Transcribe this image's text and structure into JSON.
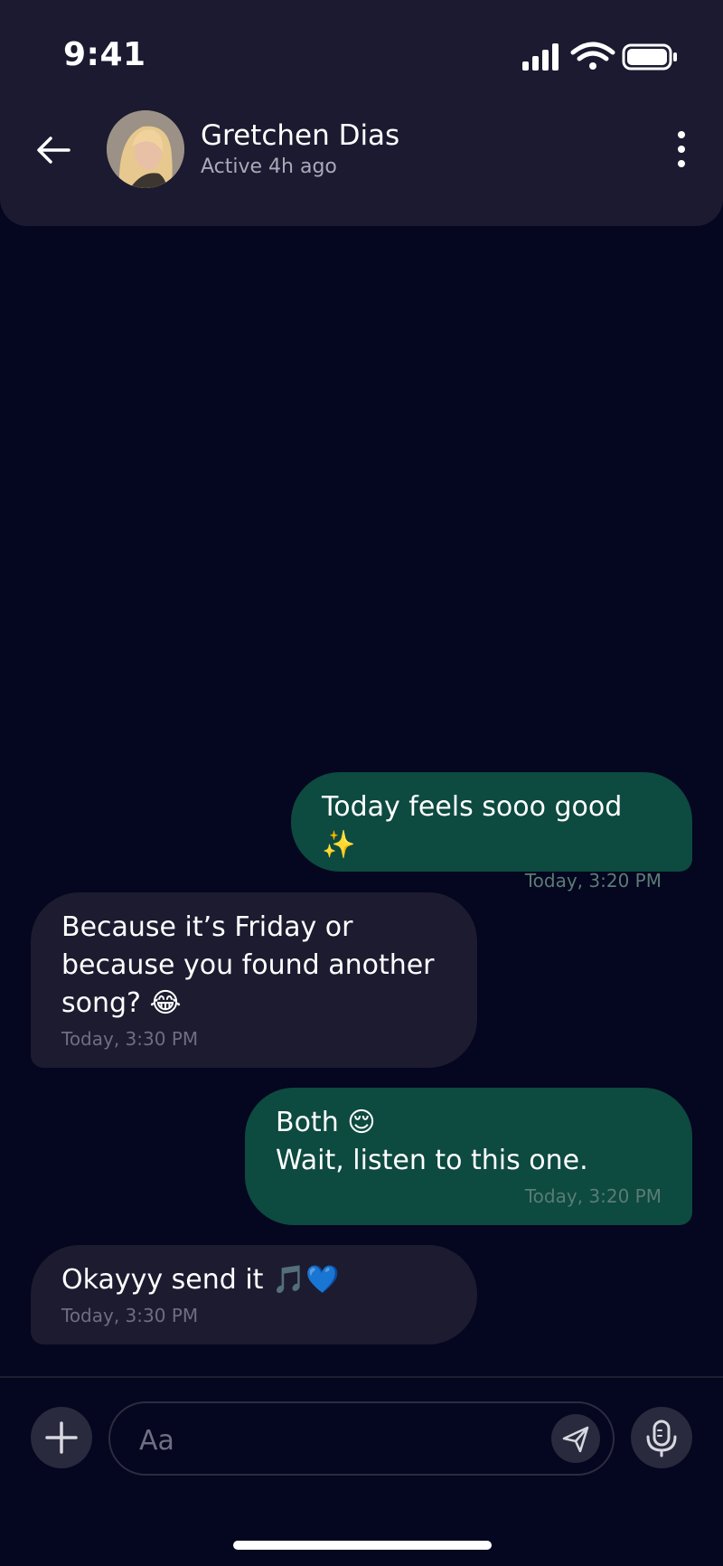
{
  "status_bar": {
    "time": "9:41",
    "icons": [
      "cellular-signal-icon",
      "wifi-icon",
      "battery-icon"
    ]
  },
  "header": {
    "back_icon": "arrow-left-icon",
    "contact_name": "Gretchen Dias",
    "contact_status": "Active 4h ago",
    "more_icon": "more-vertical-icon"
  },
  "messages": [
    {
      "direction": "sent",
      "text": "Today feels sooo good ✨",
      "time": "Today, 3:20 PM"
    },
    {
      "direction": "received",
      "text": "Because it’s Friday or\nbecause you found another\nsong? 😂",
      "time": "Today, 3:30 PM"
    },
    {
      "direction": "sent",
      "text": "Both 😌\nWait, listen to this one.",
      "time": "Today, 3:20 PM"
    },
    {
      "direction": "received",
      "text": "Okayyy send it 🎵💙",
      "time": "Today, 3:30 PM"
    }
  ],
  "composer": {
    "placeholder": "Aa",
    "value": "",
    "add_icon": "plus-icon",
    "send_icon": "send-icon",
    "mic_icon": "microphone-icon"
  },
  "colors": {
    "background": "#05061f",
    "header": "#1b1a30",
    "sent_bubble": "#0d4a40",
    "received_bubble": "#1c1b30",
    "timestamp": "#6e6e82"
  }
}
